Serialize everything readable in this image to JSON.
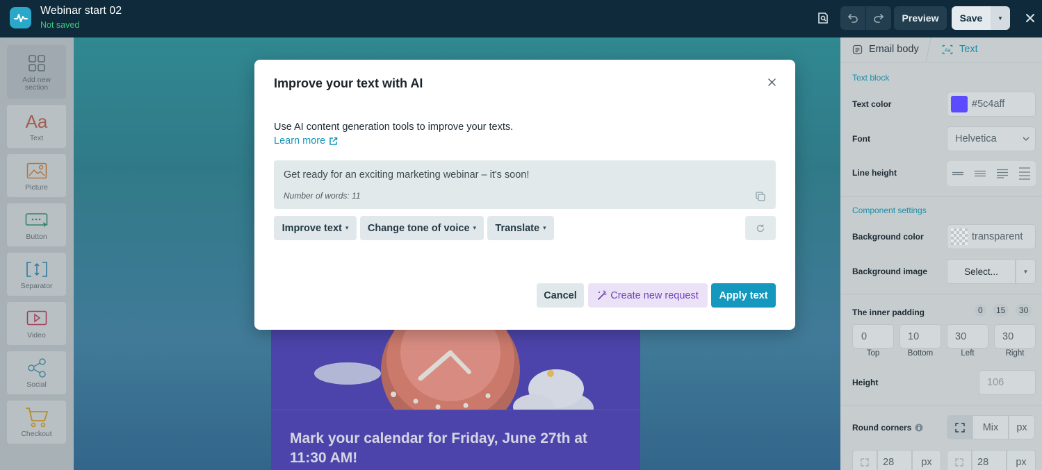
{
  "header": {
    "title": "Webinar start 02",
    "status": "Not saved",
    "preview_label": "Preview",
    "save_label": "Save"
  },
  "toolbar": {
    "items": [
      {
        "label": "Add new section",
        "icon": "grid-icon"
      },
      {
        "label": "Text",
        "icon": "text-aa-icon"
      },
      {
        "label": "Picture",
        "icon": "picture-icon"
      },
      {
        "label": "Button",
        "icon": "button-icon"
      },
      {
        "label": "Separator",
        "icon": "separator-icon"
      },
      {
        "label": "Video",
        "icon": "video-icon"
      },
      {
        "label": "Social",
        "icon": "share-icon"
      },
      {
        "label": "Checkout",
        "icon": "cart-icon"
      }
    ]
  },
  "email": {
    "headline": "Mark your calendar for Friday, June 27th at 11:30 AM!"
  },
  "modal": {
    "title": "Improve your text with AI",
    "description": "Use AI content generation tools to improve your texts.",
    "learn_more": "Learn more",
    "text": "Get ready for an exciting marketing webinar – it's soon!",
    "word_count": "Number of words: 11",
    "chips": [
      "Improve text",
      "Change tone of voice",
      "Translate"
    ],
    "cancel_label": "Cancel",
    "create_label": "Create new request",
    "apply_label": "Apply text"
  },
  "panel": {
    "breadcrumb": [
      "Email body",
      "Text"
    ],
    "text_block_section": "Text block",
    "text_color_label": "Text color",
    "text_color_value": "#5c4aff",
    "font_label": "Font",
    "font_value": "Helvetica",
    "line_height_label": "Line height",
    "component_section": "Component settings",
    "bg_color_label": "Background color",
    "bg_color_value": "transparent",
    "bg_image_label": "Background image",
    "bg_image_value": "Select...",
    "padding_label": "The inner padding",
    "padding_presets": [
      "0",
      "15",
      "30"
    ],
    "padding_values": [
      "0",
      "10",
      "30",
      "30"
    ],
    "padding_sides": [
      "Top",
      "Bottom",
      "Left",
      "Right"
    ],
    "height_label": "Height",
    "height_value": "106",
    "round_label": "Round corners",
    "round_mode": "Mix",
    "round_unit": "px",
    "corner_values": [
      "28",
      "28"
    ],
    "corner_units": [
      "px",
      "px"
    ]
  },
  "colors": {
    "accent": "#1598bd",
    "text_swatch": "#5c4aff",
    "status_green": "#3fc27f"
  }
}
